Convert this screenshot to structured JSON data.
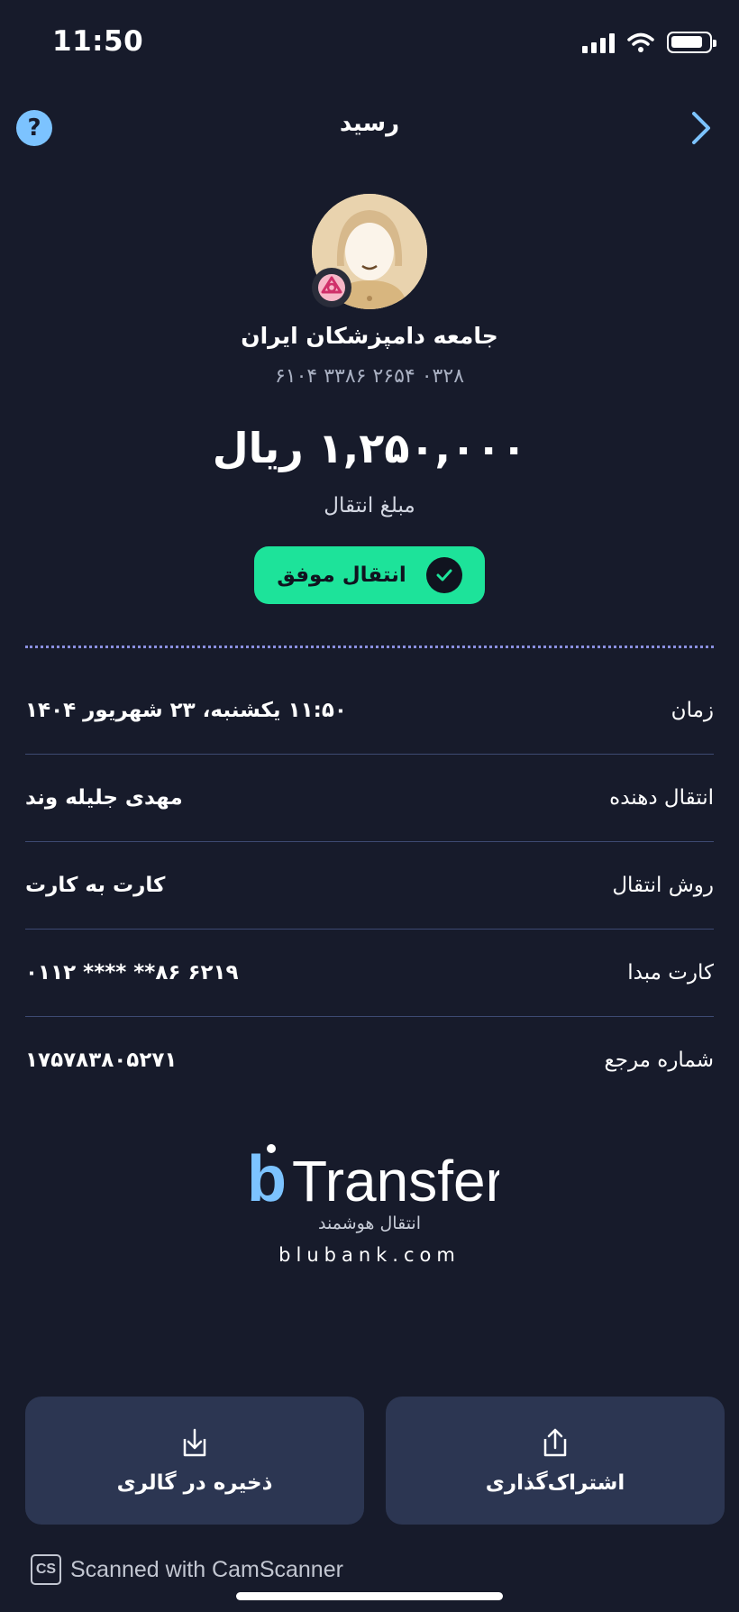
{
  "status_bar": {
    "time": "11:50"
  },
  "header": {
    "title": "رسید",
    "help_symbol": "?"
  },
  "recipient": {
    "name": "جامعه دامپزشکان ایران",
    "card_number": "۶۱۰۴ ۳۳۸۶ ۲۶۵۴ ۰۳۲۸"
  },
  "transfer": {
    "amount": "۱,۲۵۰,۰۰۰ ریال",
    "amount_label": "مبلغ انتقال",
    "status": "انتقال موفق"
  },
  "details": [
    {
      "label": "زمان",
      "value": "۱۱:۵۰ یکشنبه، ۲۳ شهریور ۱۴۰۴"
    },
    {
      "label": "انتقال دهنده",
      "value": "مهدی جلیله وند"
    },
    {
      "label": "روش انتقال",
      "value": "کارت به کارت"
    },
    {
      "label": "کارت مبدا",
      "value": "۶۲۱۹ ۸۶** **** ۰۱۱۲"
    },
    {
      "label": "شماره مرجع",
      "value": "۱۷۵۷۸۳۸۰۵۲۷۱"
    }
  ],
  "brand": {
    "logo_letter": "b",
    "logo_text": "Transfer",
    "subtitle": "انتقال هوشمند",
    "url": "blubank.com"
  },
  "actions": {
    "save_label": "ذخیره در گالری",
    "share_label": "اشتراک‌گذاری"
  },
  "footer": {
    "scanner_badge": "CS",
    "scanner_text": "Scanned with CamScanner"
  },
  "colors": {
    "background": "#171b2b",
    "success": "#1de39a",
    "accent": "#7cc3ff",
    "button_bg": "#2c3652",
    "divider": "#3d4a72"
  }
}
